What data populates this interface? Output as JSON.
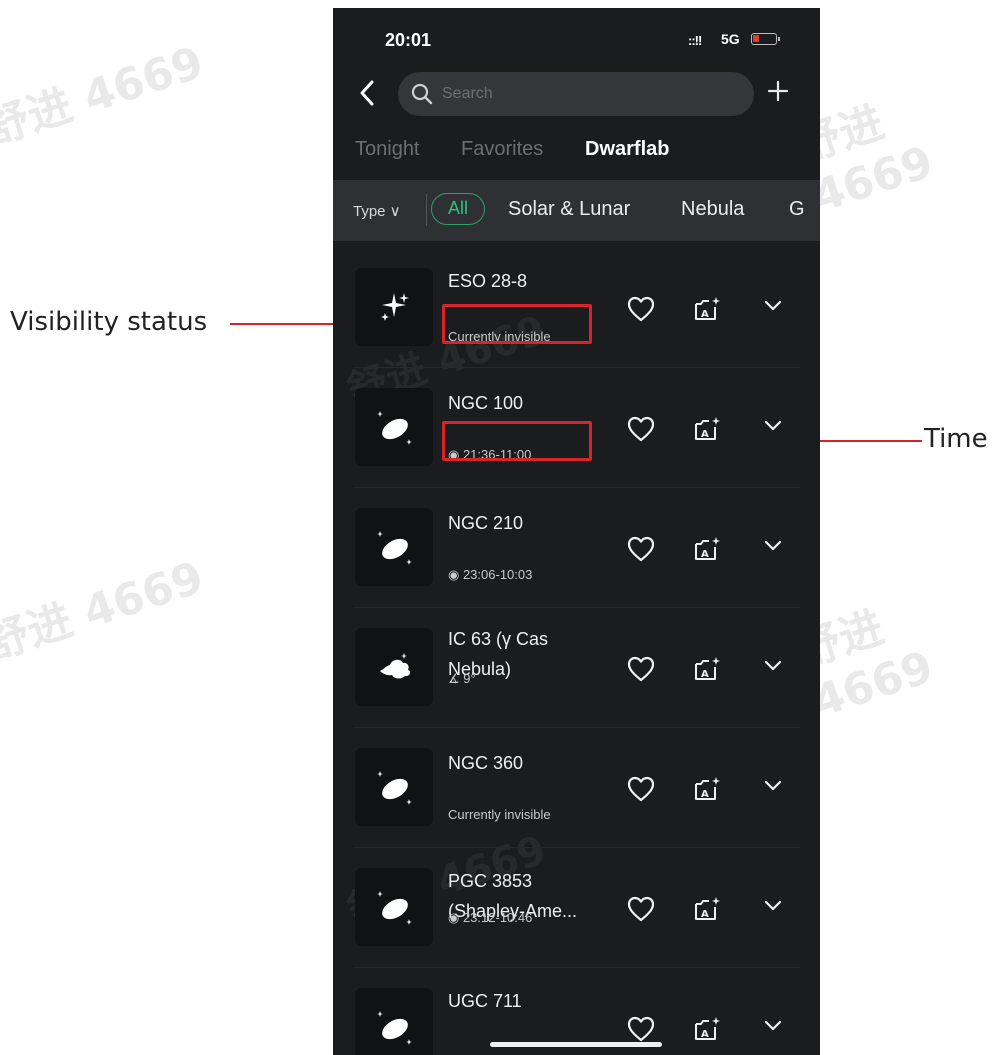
{
  "annotations": {
    "visibility_status": "Visibility status",
    "time": "Time"
  },
  "status_bar": {
    "time": "20:01",
    "signal": "::!!",
    "network": "5G"
  },
  "search": {
    "placeholder": "Search"
  },
  "tabs": [
    {
      "label": "Tonight"
    },
    {
      "label": "Favorites"
    },
    {
      "label": "Dwarflab"
    }
  ],
  "filter": {
    "type_label": "Type ∨",
    "chips": [
      {
        "label": "All"
      },
      {
        "label": "Solar & Lunar"
      },
      {
        "label": "Nebula"
      },
      {
        "label": "G"
      }
    ]
  },
  "objects": [
    {
      "name": "ESO 28-8",
      "meta": "Currently invisible",
      "icon": "star-cluster-icon"
    },
    {
      "name": "NGC 100",
      "meta": "◉ 21:36-11:00",
      "icon": "galaxy-icon"
    },
    {
      "name": "NGC 210",
      "meta": "◉ 23:06-10:03",
      "icon": "galaxy-icon"
    },
    {
      "name": "IC 63 (γ Cas Nebula)",
      "meta": "∡ 9°",
      "icon": "nebula-icon"
    },
    {
      "name": "NGC 360",
      "meta": "Currently invisible",
      "icon": "galaxy-icon"
    },
    {
      "name": "PGC 3853 (Shapley-Ame...",
      "meta": "◉ 23:12-10:46",
      "icon": "galaxy-icon"
    },
    {
      "name": "UGC 711",
      "meta": "",
      "icon": "galaxy-icon"
    }
  ],
  "watermark": "舒进 4669",
  "colors": {
    "accent": "#2ec07c",
    "highlight": "#d8232a",
    "background": "#1b1c1e"
  }
}
